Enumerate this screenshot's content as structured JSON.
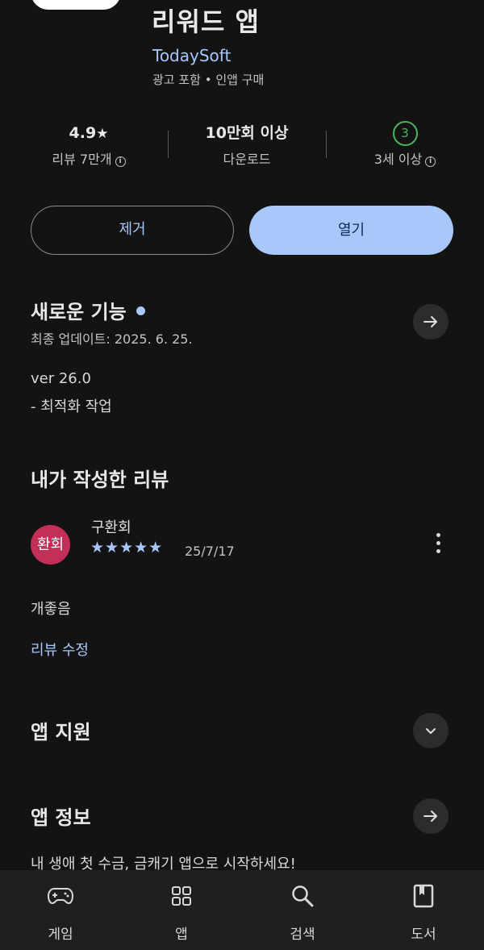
{
  "app": {
    "title": "리워드 앱",
    "developer": "TodaySoft",
    "meta": "광고 포함 • 인앱 구매"
  },
  "stats": {
    "rating": "4.9",
    "rating_star": "★",
    "reviews_label": "리뷰 7만개",
    "downloads": "10만회 이상",
    "downloads_label": "다운로드",
    "age_badge": "3",
    "age_label": "3세 이상",
    "info_glyph": "i"
  },
  "actions": {
    "remove_label": "제거",
    "open_label": "열기"
  },
  "whats_new": {
    "title": "새로운 기능",
    "updated": "최종 업데이트: 2025. 6. 25.",
    "version": "ver 26.0",
    "note": "- 최적화 작업"
  },
  "my_review": {
    "title": "내가 작성한 리뷰",
    "avatar_text": "환회",
    "author": "구환회",
    "stars": "★★★★★",
    "rating": 5,
    "date": "25/7/17",
    "text": "개좋음",
    "edit_label": "리뷰 수정"
  },
  "app_support": {
    "title": "앱 지원"
  },
  "app_info": {
    "title": "앱 정보",
    "description": "내 생애 첫 수금, 금캐기 앱으로 시작하세요!"
  },
  "bottom_nav": {
    "items": [
      {
        "label": "게임",
        "icon": "gamepad-icon"
      },
      {
        "label": "앱",
        "icon": "apps-grid-icon"
      },
      {
        "label": "검색",
        "icon": "search-icon"
      },
      {
        "label": "도서",
        "icon": "book-icon"
      }
    ]
  },
  "colors": {
    "background": "#131313",
    "accent": "#a8c7fa",
    "avatar": "#c2305a",
    "age_badge": "#4bb35e",
    "nav_bar": "#1f1f20"
  }
}
